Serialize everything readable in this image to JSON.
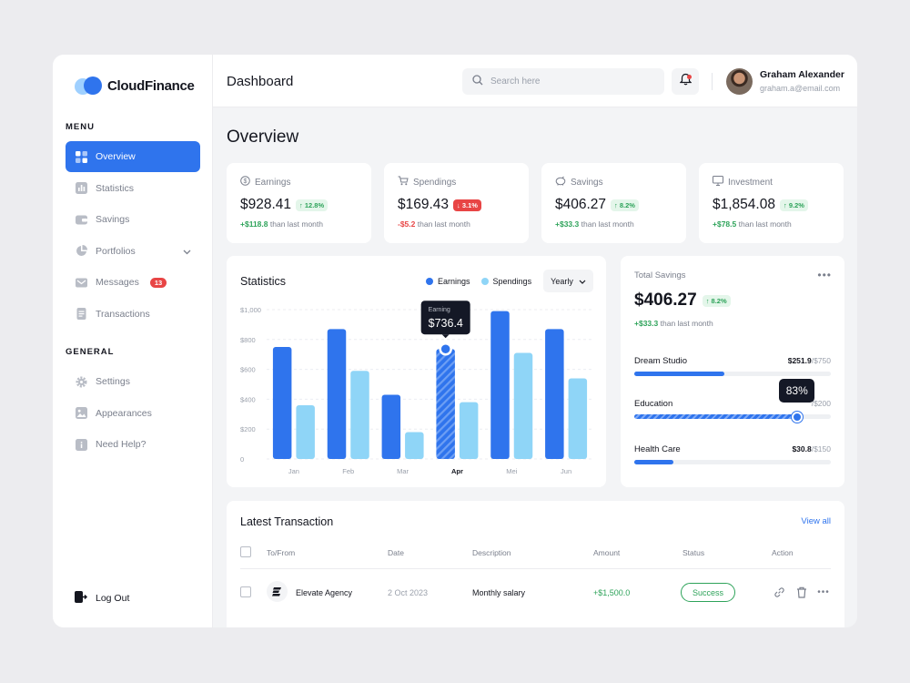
{
  "app": {
    "name": "CloudFinance",
    "page_title": "Dashboard"
  },
  "sidebar": {
    "menu_label": "MENU",
    "general_label": "GENERAL",
    "menu_items": [
      {
        "label": "Overview",
        "icon": "grid-icon",
        "active": true
      },
      {
        "label": "Statistics",
        "icon": "bar-chart-icon"
      },
      {
        "label": "Savings",
        "icon": "wallet-icon"
      },
      {
        "label": "Portfolios",
        "icon": "pie-chart-icon"
      },
      {
        "label": "Messages",
        "icon": "mail-icon",
        "badge": "13"
      },
      {
        "label": "Transactions",
        "icon": "document-icon"
      }
    ],
    "general_items": [
      {
        "label": "Settings",
        "icon": "gear-icon"
      },
      {
        "label": "Appearances",
        "icon": "image-icon"
      },
      {
        "label": "Need Help?",
        "icon": "info-icon"
      }
    ],
    "logout_label": "Log Out"
  },
  "topbar": {
    "search_placeholder": "Search here",
    "user_name": "Graham Alexander",
    "user_email": "graham.a@email.com"
  },
  "overview": {
    "title": "Overview",
    "kpis": [
      {
        "label": "Earnings",
        "icon": "dollar-circle-icon",
        "value": "$928.41",
        "change": "12.8%",
        "direction": "up",
        "delta": "+$118.8",
        "delta_text": "than last month"
      },
      {
        "label": "Spendings",
        "icon": "cart-icon",
        "value": "$169.43",
        "change": "3.1%",
        "direction": "down",
        "delta": "-$5.2",
        "delta_text": "than last month"
      },
      {
        "label": "Savings",
        "icon": "piggy-bank-icon",
        "value": "$406.27",
        "change": "8.2%",
        "direction": "up",
        "delta": "+$33.3",
        "delta_text": "than last month"
      },
      {
        "label": "Investment",
        "icon": "monitor-icon",
        "value": "$1,854.08",
        "change": "9.2%",
        "direction": "up",
        "delta": "+$78.5",
        "delta_text": "than last month"
      }
    ]
  },
  "statistics": {
    "title": "Statistics",
    "period": "Yearly",
    "tooltip_label": "Earning",
    "tooltip_value": "$736.4",
    "colors": {
      "earnings": "#2f74ed",
      "spendings": "#8fd5f7"
    }
  },
  "chart_data": {
    "type": "bar",
    "categories": [
      "Jan",
      "Feb",
      "Mar",
      "Apr",
      "Mei",
      "Jun"
    ],
    "highlighted_category": "Apr",
    "series": [
      {
        "name": "Earnings",
        "values": [
          750,
          870,
          430,
          736.4,
          990,
          870
        ]
      },
      {
        "name": "Spendings",
        "values": [
          360,
          590,
          180,
          380,
          710,
          540
        ]
      }
    ],
    "ytick_labels": [
      "$1,000",
      "$800",
      "$600",
      "$400",
      "$200",
      "0"
    ],
    "ylim": [
      0,
      1000
    ],
    "grid": true,
    "legend": "top-right"
  },
  "total_savings": {
    "label": "Total Savings",
    "value": "$406.27",
    "change": "8.2%",
    "delta": "+$33.3",
    "delta_text": "than last month",
    "goals": [
      {
        "name": "Dream Studio",
        "current": "$251.9",
        "target": "/$750",
        "progress": 0.46
      },
      {
        "name": "Education",
        "current": "",
        "target": "/$200",
        "progress": 0.83,
        "tooltip": "83%"
      },
      {
        "name": "Health Care",
        "current": "$30.8",
        "target": "/$150",
        "progress": 0.2
      }
    ]
  },
  "transactions": {
    "title": "Latest Transaction",
    "view_all": "View all",
    "columns": [
      "To/From",
      "Date",
      "Description",
      "Amount",
      "Status",
      "Action"
    ],
    "rows": [
      {
        "name": "Elevate Agency",
        "date": "2 Oct 2023",
        "description": "Monthly salary",
        "amount": "+$1,500.0",
        "status": "Success"
      }
    ]
  }
}
